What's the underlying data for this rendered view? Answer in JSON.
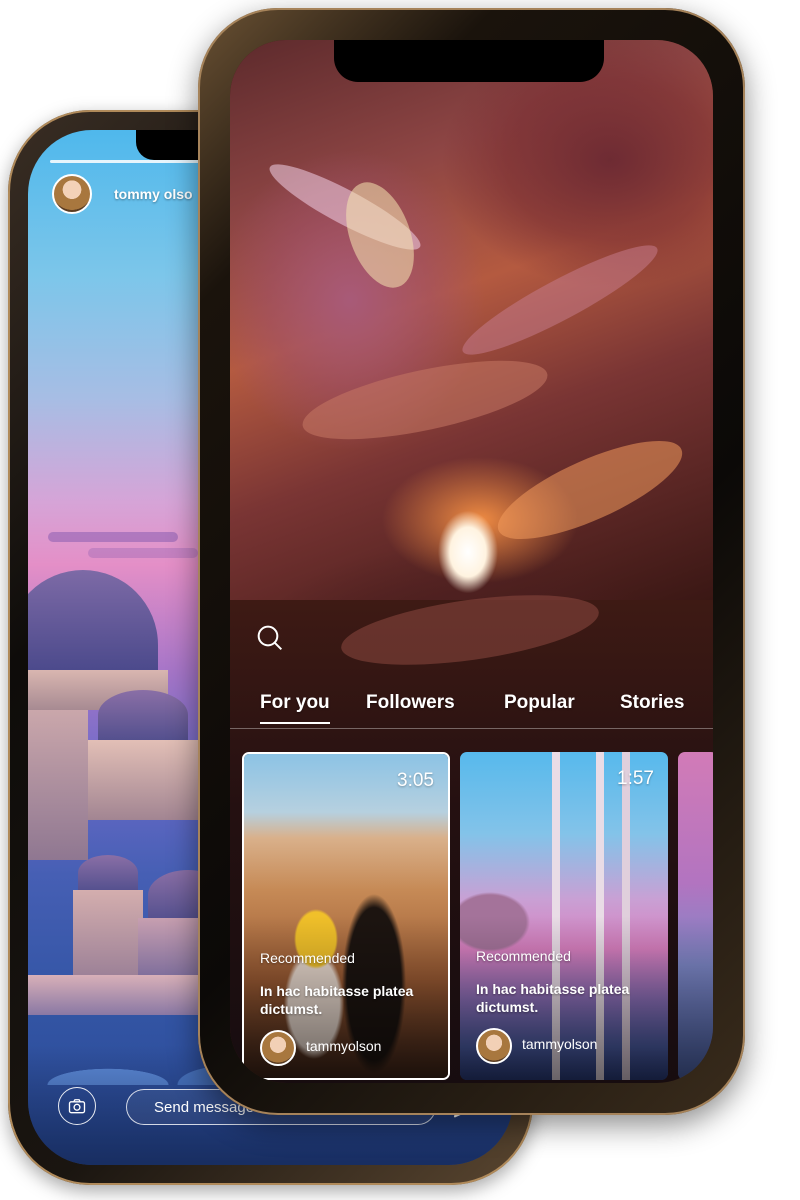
{
  "back_phone": {
    "story_username": "tommy olso",
    "message_placeholder": "Send message",
    "more_icon_glyph": "•••",
    "icons": [
      "camera-icon",
      "more-icon",
      "send-icon"
    ]
  },
  "front_phone": {
    "tabs": [
      {
        "label": "For you",
        "active": true
      },
      {
        "label": "Followers",
        "active": false
      },
      {
        "label": "Popular",
        "active": false
      },
      {
        "label": "Stories",
        "active": false
      }
    ],
    "cards": [
      {
        "duration": "3:05",
        "tag": "Recommended",
        "description": "In hac habitasse platea dictumst.",
        "username": "tammyolson",
        "selected": true
      },
      {
        "duration": "1:57",
        "tag": "Recommended",
        "description": "In hac habitasse platea dictumst.",
        "username": "tammyolson",
        "selected": false
      }
    ],
    "icons": [
      "search-icon"
    ]
  },
  "colors": {
    "text": "#ffffff",
    "frame_gold": "#a6835a"
  }
}
